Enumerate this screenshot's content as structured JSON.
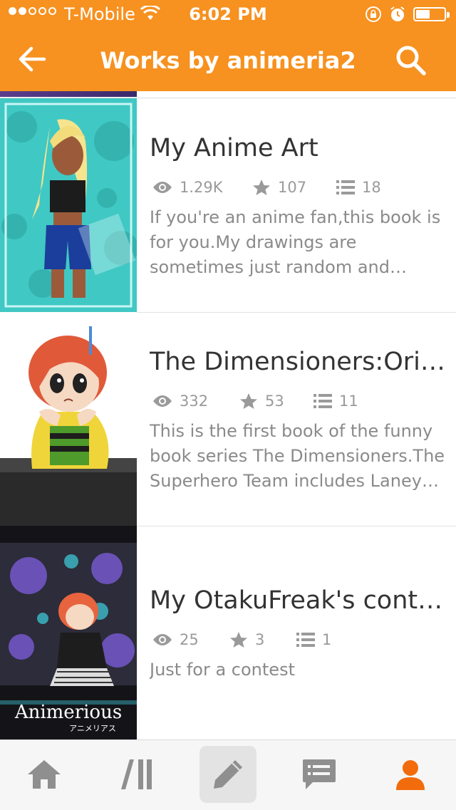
{
  "status_bar": {
    "carrier": "T-Mobile",
    "time": "6:02 PM",
    "signal_bars_filled": 2,
    "signal_bars_total": 5,
    "battery_level": 0.5
  },
  "nav": {
    "title": "Works by animeria2",
    "back_icon": "arrow-left-icon",
    "search_icon": "search-icon"
  },
  "works": [
    {
      "title": "My Anime Art",
      "views": "1.29K",
      "votes": "107",
      "parts": "18",
      "description": "If you're an anime fan,this book is for you.My drawings are sometimes just random and sometimes have…"
    },
    {
      "title": "The Dimensioners:Orig…",
      "views": "332",
      "votes": "53",
      "parts": "11",
      "description": "This is the first book of the funny book series The Dimensioners.The Superhero Team includes Laney P…"
    },
    {
      "title": "My OtakuFreak's conte…",
      "views": "25",
      "votes": "3",
      "parts": "1",
      "description": "Just for a contest"
    }
  ],
  "cover3_logo_text": "Animerious",
  "cover3_logo_sub": "アニメリアス",
  "tabs": [
    {
      "icon": "home-icon"
    },
    {
      "icon": "library-icon"
    },
    {
      "icon": "pencil-icon",
      "selected_box": true
    },
    {
      "icon": "messages-icon"
    },
    {
      "icon": "profile-icon",
      "active": true
    }
  ],
  "colors": {
    "brand": "#f7911f",
    "tab_icon": "#8f8f8f",
    "tab_active": "#f26c0d",
    "stat_text": "#9a9a9a"
  }
}
